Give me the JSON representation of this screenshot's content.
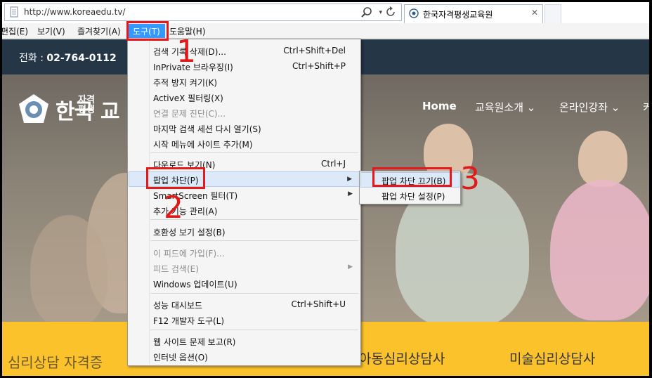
{
  "browser": {
    "url": "http://www.koreaedu.tv/",
    "tab_title": "한국자격평생교육원",
    "tab_close": "✕",
    "dropdown_glyph": "▾"
  },
  "menubar": {
    "items": [
      "편집(E)",
      "보기(V)",
      "즐겨찾기(A)",
      "도구(T)",
      "도움말(H)"
    ]
  },
  "tools_menu": {
    "items": [
      {
        "label": "검색 기록 삭제(D)...",
        "shortcut": "Ctrl+Shift+Del"
      },
      {
        "label": "InPrivate 브라우징(I)",
        "shortcut": "Ctrl+Shift+P"
      },
      {
        "label": "추적 방지 켜기(K)",
        "shortcut": ""
      },
      {
        "label": "ActiveX 필터링(X)",
        "shortcut": ""
      },
      {
        "label": "연결 문제 진단(C)...",
        "shortcut": ""
      },
      {
        "label": "마지막 검색 세션 다시 열기(S)",
        "shortcut": ""
      },
      {
        "label": "시작 메뉴에 사이트 추가(M)",
        "shortcut": ""
      },
      {
        "label": "다운로드 보기(N)",
        "shortcut": "Ctrl+J"
      },
      {
        "label": "팝업 차단(P)",
        "shortcut": ""
      },
      {
        "label": "SmartScreen 필터(T)",
        "shortcut": ""
      },
      {
        "label": "추가 기능 관리(A)",
        "shortcut": ""
      },
      {
        "label": "호환성 보기 설정(B)",
        "shortcut": ""
      },
      {
        "label": "이 피드에 가입(F)...",
        "shortcut": ""
      },
      {
        "label": "피드 검색(E)",
        "shortcut": ""
      },
      {
        "label": "Windows 업데이트(U)",
        "shortcut": ""
      },
      {
        "label": "성능 대시보드",
        "shortcut": "Ctrl+Shift+U"
      },
      {
        "label": "F12 개발자 도구(L)",
        "shortcut": ""
      },
      {
        "label": "웹 사이트 문제 보고(R)",
        "shortcut": ""
      },
      {
        "label": "인터넷 옵션(O)",
        "shortcut": ""
      }
    ],
    "arrow_glyph": "▶"
  },
  "popup_submenu": {
    "items": [
      "팝업 차단 끄기(B)",
      "팝업 차단 설정(P)"
    ]
  },
  "site": {
    "phone_label": "전화 : ",
    "phone_number": "02-764-0112",
    "logo_text": "한국",
    "logo_sub_1": "자격",
    "logo_sub_2": "평생",
    "logo_tail": "교",
    "nav": [
      "Home",
      "교육원소개 ⌄",
      "온라인강좌 ⌄",
      "커"
    ],
    "band_left": "심리상담 자격증",
    "band_mid": "아동심리상담사",
    "band_right": "미술심리상담사"
  },
  "annotations": {
    "step1": "1",
    "step2": "2",
    "step3": "3",
    "color": "#e81818"
  },
  "colors": {
    "menu_highlight": "#3399ff",
    "topbar": "#253647",
    "band": "#fbc22b"
  }
}
